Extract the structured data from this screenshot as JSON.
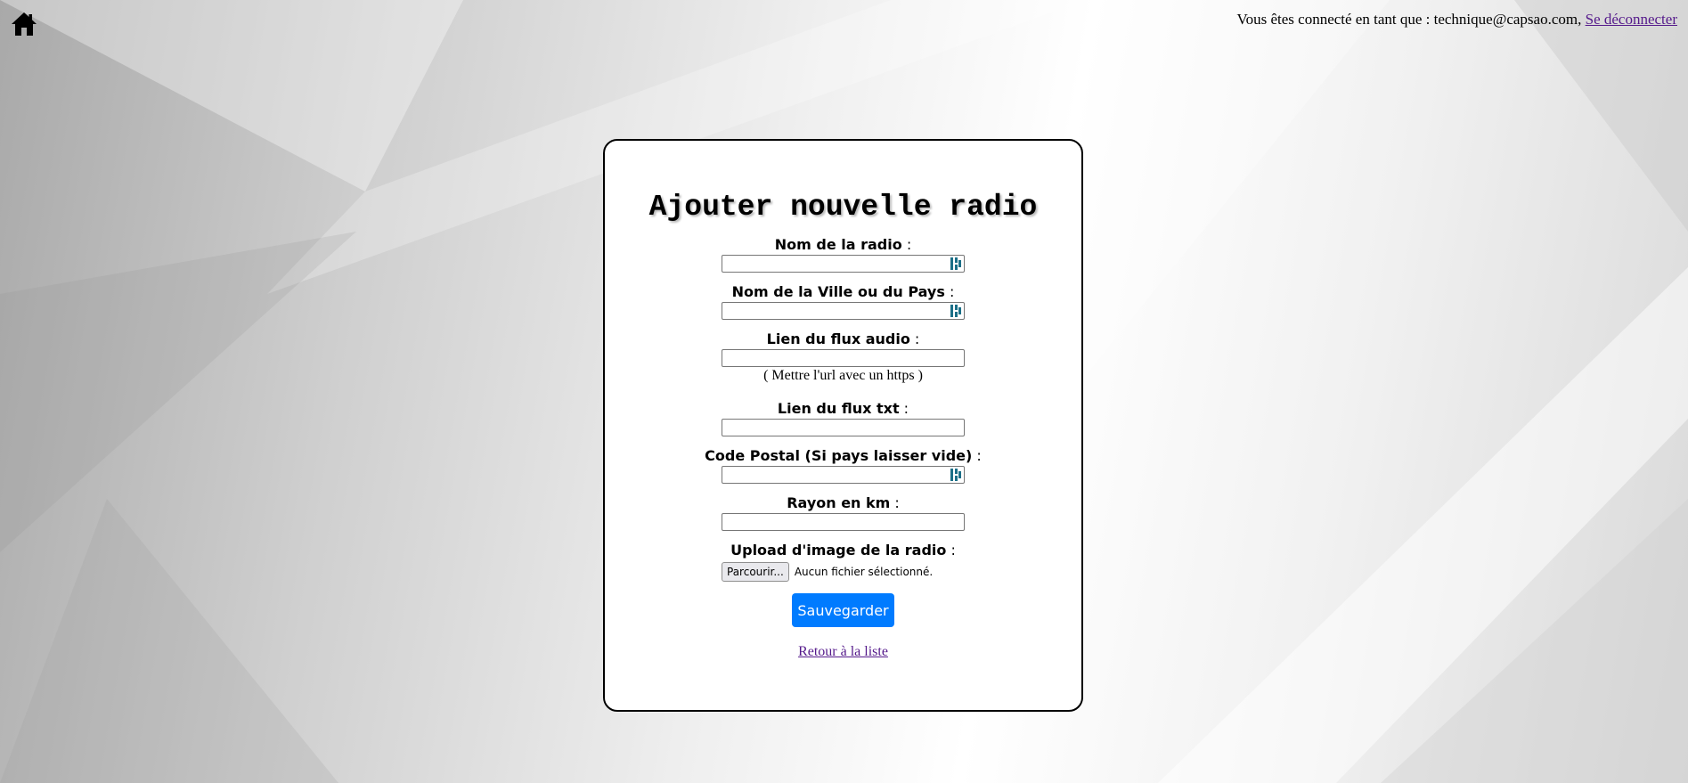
{
  "header": {
    "home_icon": "home-icon",
    "login_prefix": "Vous êtes connecté en tant que : technique@capsao.com,",
    "logout_label": "Se déconnecter"
  },
  "form": {
    "title": "Ajouter nouvelle radio",
    "fields": {
      "name": {
        "label": "Nom de la radio",
        "value": ""
      },
      "city": {
        "label": "Nom de la Ville ou du Pays",
        "value": ""
      },
      "stream": {
        "label": "Lien du flux audio",
        "value": "",
        "hint": "( Mettre l'url avec un https )"
      },
      "txt": {
        "label": "Lien du flux txt",
        "value": ""
      },
      "postal": {
        "label": "Code Postal (Si pays laisser vide)",
        "value": ""
      },
      "radius": {
        "label": "Rayon en km",
        "value": ""
      },
      "image": {
        "label": "Upload d'image de la radio",
        "button_label": "Parcourir...",
        "no_file_text": "Aucun fichier sélectionné."
      }
    },
    "colon": " :",
    "save_label": "Sauvegarder",
    "back_label": "Retour à la liste"
  },
  "colors": {
    "accent": "#007bff",
    "visited_link": "#551a8b"
  }
}
